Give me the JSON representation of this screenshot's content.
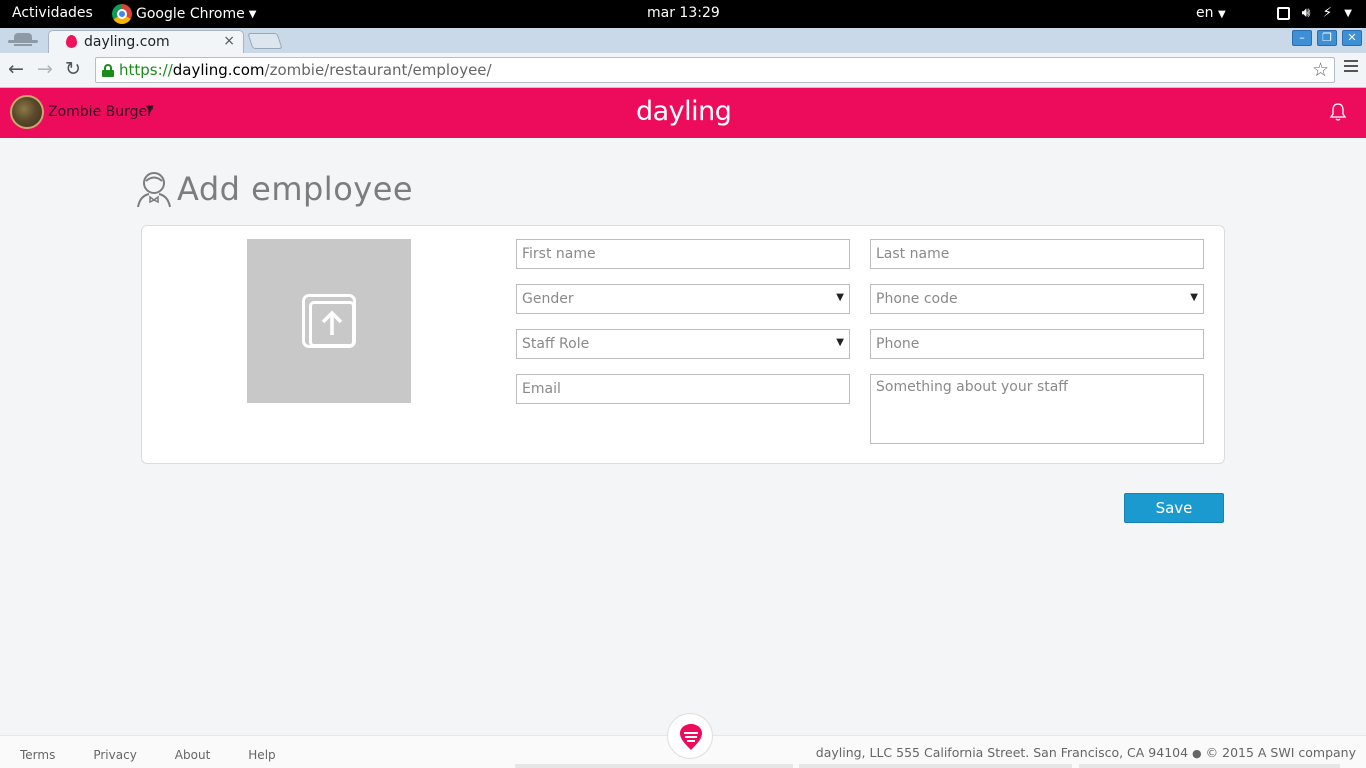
{
  "system_bar": {
    "activities": "Actividades",
    "app_name": "Google Chrome",
    "clock": "mar 13:29",
    "language": "en"
  },
  "browser": {
    "tab_title": "dayling.com",
    "tab_close": "×",
    "url_scheme": "https://",
    "url_host": "dayling.com",
    "url_path": "/zombie/restaurant/employee/"
  },
  "header": {
    "account_name": "Zombie Burger",
    "account_caret": "▼",
    "brand": "dayling",
    "brand_color": "#ed0c5b"
  },
  "page": {
    "title": "Add employee"
  },
  "form": {
    "first_name_placeholder": "First name",
    "last_name_placeholder": "Last name",
    "gender_label": "Gender",
    "phone_code_label": "Phone code",
    "staff_role_label": "Staff Role",
    "phone_placeholder": "Phone",
    "email_placeholder": "Email",
    "bio_placeholder": "Something about your staff",
    "save_label": "Save",
    "save_color": "#1b9ad0"
  },
  "footer": {
    "links": [
      "Terms",
      "Privacy",
      "About",
      "Help"
    ],
    "company_text": "dayling, LLC 555 California Street. San Francisco, CA 94104",
    "copyright": "© 2015 A SWI company"
  }
}
